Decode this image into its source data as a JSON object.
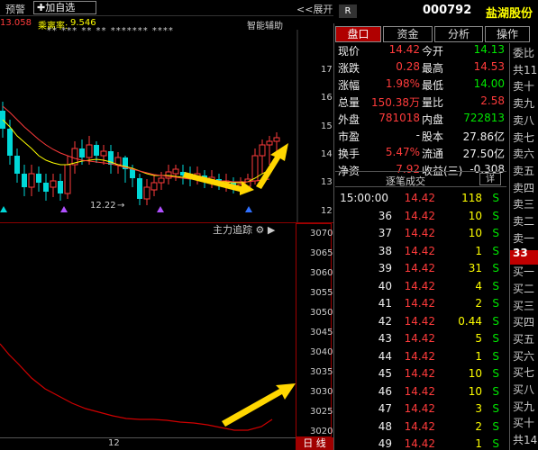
{
  "chart": {
    "toolbar": {
      "label": "预警",
      "add_label": "加自选",
      "expand_label": "展开"
    },
    "indicator": {
      "val1": "13.058",
      "name": "乘离率:",
      "val2": "9.546",
      "stars": "** *** ** ** ******* ****",
      "aux_label": "智能辅助"
    },
    "price_ticks": [
      "17",
      "16",
      "15",
      "14",
      "13",
      "12"
    ],
    "low_label": "12.22",
    "sub_title": "主力追踪",
    "sub_ticks": [
      "3070",
      "3065",
      "3060",
      "3055",
      "3050",
      "3045",
      "3040",
      "3035",
      "3030",
      "3025",
      "3020",
      "3015"
    ],
    "bottom_label": "12",
    "day_tab": "日 线",
    "colors": {
      "up": "#ff3b3b",
      "down": "#00d8d8",
      "ma1": "#ffff00",
      "ma2": "#ff3b3b",
      "arrow": "#ffd700"
    }
  },
  "stock": {
    "badge": "R",
    "code": "000792",
    "name": "盐湖股份"
  },
  "tabs": [
    "盘口",
    "资金",
    "分析",
    "操作"
  ],
  "quote": {
    "rows": [
      {
        "l1": "现价",
        "v1": "14.42",
        "l2": "今开",
        "v2": "14.13"
      },
      {
        "l1": "涨跌",
        "v1": "0.28",
        "l2": "最高",
        "v2": "14.53"
      },
      {
        "l1": "涨幅",
        "v1": "1.98%",
        "l2": "最低",
        "v2": "14.00"
      },
      {
        "l1": "总量",
        "v1": "150.38万",
        "l2": "量比",
        "v2": "2.58"
      },
      {
        "l1": "外盘",
        "v1": "781018",
        "l2": "内盘",
        "v2": "722813"
      },
      {
        "l1": "市盈",
        "v1": "-",
        "l2": "股本",
        "v2": "27.86亿"
      },
      {
        "l1": "换手",
        "v1": "5.47%",
        "l2": "流通",
        "v2": "27.50亿"
      },
      {
        "l1": "净资",
        "v1": "7.92",
        "l2": "收益(三)",
        "v2": "-0.308"
      }
    ]
  },
  "trades": {
    "title": "逐笔成交",
    "detail": "详",
    "rows": [
      {
        "time": "15:00:00",
        "price": "14.42",
        "vol": "118",
        "side": "S"
      },
      {
        "time": "36",
        "price": "14.42",
        "vol": "10",
        "side": "S"
      },
      {
        "time": "37",
        "price": "14.42",
        "vol": "10",
        "side": "S"
      },
      {
        "time": "38",
        "price": "14.42",
        "vol": "1",
        "side": "S"
      },
      {
        "time": "39",
        "price": "14.42",
        "vol": "31",
        "side": "S"
      },
      {
        "time": "40",
        "price": "14.42",
        "vol": "4",
        "side": "S"
      },
      {
        "time": "41",
        "price": "14.42",
        "vol": "2",
        "side": "S"
      },
      {
        "time": "42",
        "price": "14.42",
        "vol": "0.44",
        "side": "S"
      },
      {
        "time": "43",
        "price": "14.42",
        "vol": "5",
        "side": "S"
      },
      {
        "time": "44",
        "price": "14.42",
        "vol": "1",
        "side": "S"
      },
      {
        "time": "45",
        "price": "14.42",
        "vol": "10",
        "side": "S"
      },
      {
        "time": "46",
        "price": "14.42",
        "vol": "10",
        "side": "S"
      },
      {
        "time": "47",
        "price": "14.42",
        "vol": "3",
        "side": "S"
      },
      {
        "time": "48",
        "price": "14.42",
        "vol": "2",
        "side": "S"
      },
      {
        "time": "49",
        "price": "14.42",
        "vol": "1",
        "side": "S"
      },
      {
        "time": "50",
        "price": "14.42",
        "vol": "0.56",
        "side": "S"
      }
    ]
  },
  "side_list": [
    "委比",
    "共11",
    "卖十",
    "卖九",
    "卖八",
    "卖七",
    "卖六",
    "卖五",
    "卖四",
    "卖三",
    "卖二",
    "卖一",
    "33",
    "买一",
    "买二",
    "买三",
    "买四",
    "买五",
    "买六",
    "买七",
    "买八",
    "买九",
    "买十",
    "共14"
  ]
}
